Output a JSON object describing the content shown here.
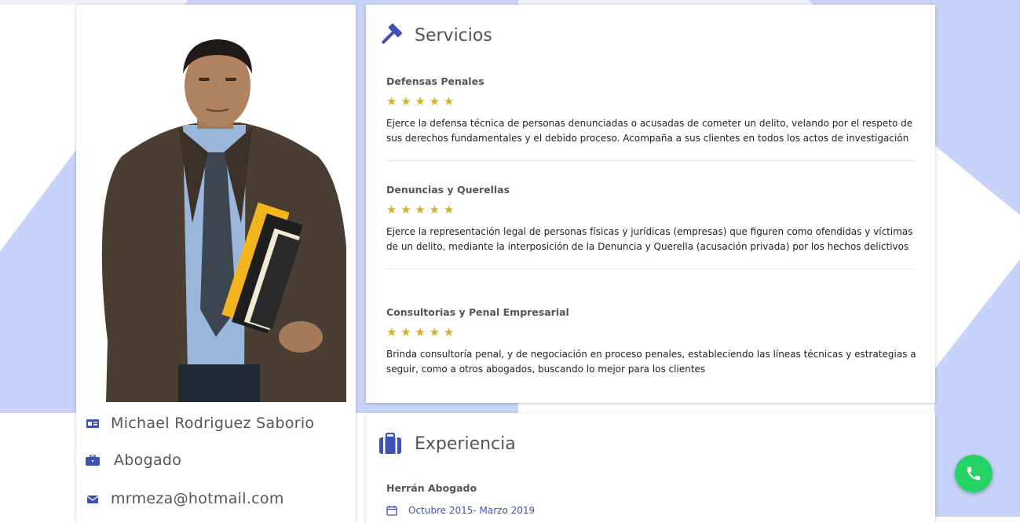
{
  "colors": {
    "accent": "#3f51b5",
    "star": "#d4b022",
    "background_shape": "#c8d3fb",
    "whatsapp": "#25d366"
  },
  "profile": {
    "photo_description": "lawyer-portrait",
    "name": "Michael Rodriguez Saborio",
    "profession": "Abogado",
    "email": "mrmeza@hotmail.com",
    "name_icon": "id-card-icon",
    "profession_icon": "briefcase-icon",
    "email_icon": "envelope-icon"
  },
  "services": {
    "title": "Servicios",
    "icon": "gavel-icon",
    "items": [
      {
        "title": "Defensas Penales",
        "rating": 5,
        "stars": "★ ★ ★ ★ ★",
        "description": "Ejerce la defensa técnica de personas denunciadas o acusadas de cometer un delito, velando por el respeto de sus derechos fundamentales y el debido proceso. Acompaña a sus clientes en todos los actos de investigación"
      },
      {
        "title": "Denuncias y Querellas",
        "rating": 5,
        "stars": "★ ★ ★ ★ ★",
        "description": "Ejerce la representación legal de personas físicas y jurídicas (empresas) que figuren como ofendidas y víctimas de un delito, mediante la interposición de la Denuncia y Querella (acusación privada) por los hechos delictivos"
      },
      {
        "title": "Consultorias y Penal Empresarial",
        "rating": 5,
        "stars": "★ ★ ★ ★ ★",
        "description": "Brinda consultoría penal, y de negociación en proceso penales, estableciendo las líneas técnicas y estrategias a seguir, como a otros abogados, buscando lo mejor para los clientes"
      }
    ]
  },
  "experience": {
    "title": "Experiencia",
    "icon": "suitcase-icon",
    "company": "Herrán Abogado",
    "date_icon": "calendar-icon",
    "dates": "Octubre 2015- Marzo 2019"
  },
  "whatsapp_button": {
    "icon": "phone-icon"
  }
}
